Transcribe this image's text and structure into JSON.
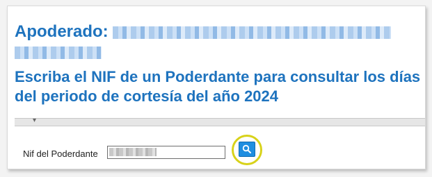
{
  "header": {
    "apoderado_label": "Apoderado:"
  },
  "main": {
    "heading": "Escriba el NIF de un Poderdante para consultar los días del periodo de cortesía del año 2024"
  },
  "toolbar": {
    "collapse_glyph": "▾"
  },
  "form": {
    "nif_label": "Nif del Poderdante",
    "nif_value": "",
    "search_icon": "search-icon"
  },
  "colors": {
    "accent": "#1e73be",
    "button": "#1f8ee0",
    "highlight": "#d8d21a"
  }
}
